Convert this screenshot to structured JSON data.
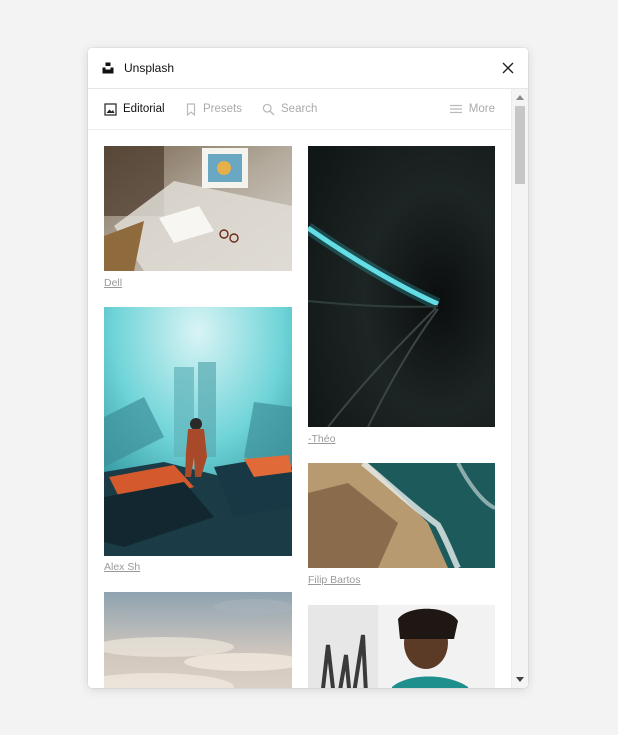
{
  "app": {
    "title": "Unsplash"
  },
  "tabs": [
    {
      "label": "Editorial",
      "active": true,
      "icon": "image-icon"
    },
    {
      "label": "Presets",
      "active": false,
      "icon": "bookmark-icon"
    },
    {
      "label": "Search",
      "active": false,
      "icon": "search-icon"
    },
    {
      "label": "More",
      "active": false,
      "icon": "menu-icon"
    }
  ],
  "photos": [
    {
      "credit": "Dell"
    },
    {
      "credit": "Alex Sh"
    },
    {
      "credit": ""
    },
    {
      "credit": "-Théo"
    },
    {
      "credit": "Filip Bartos"
    },
    {
      "credit": ""
    }
  ],
  "colors": {
    "background": "#f3f3f3",
    "panel": "#ffffff",
    "active_tab": "#111111",
    "inactive_tab": "#aaaaaa",
    "credit": "#9a9a9a"
  }
}
